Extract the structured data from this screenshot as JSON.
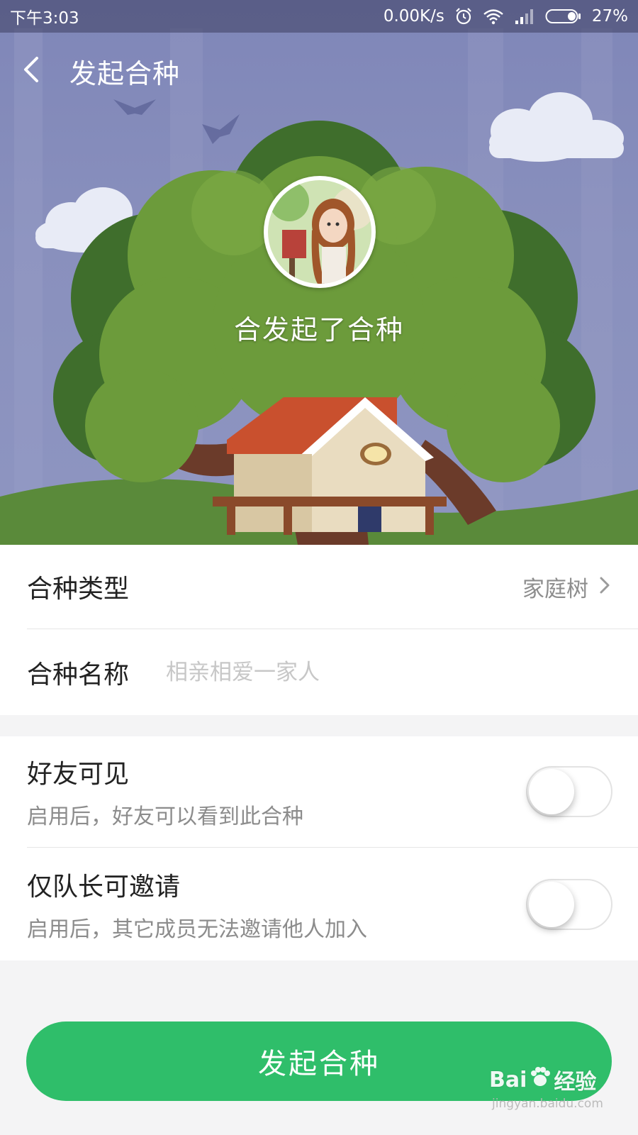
{
  "status_bar": {
    "time": "下午3:03",
    "network_speed": "0.00K/s",
    "battery": "27%",
    "icons": [
      "alarm-icon",
      "wifi-icon",
      "signal-icon",
      "battery-icon"
    ]
  },
  "nav": {
    "back_icon": "chevron-left-icon",
    "title": "发起合种"
  },
  "hero": {
    "caption": "合发起了合种"
  },
  "form": {
    "type_label": "合种类型",
    "type_value": "家庭树",
    "name_label": "合种名称",
    "name_value": "",
    "name_placeholder": "相亲相爱一家人"
  },
  "options": [
    {
      "title": "好友可见",
      "description": "启用后，好友可以看到此合种",
      "enabled": false
    },
    {
      "title": "仅队长可邀请",
      "description": "启用后，其它成员无法邀请他人加入",
      "enabled": false
    }
  ],
  "submit_label": "发起合种",
  "watermark": {
    "brand": "Bai",
    "brand_suffix": "经验",
    "url": "jingyan.baidu.com"
  },
  "colors": {
    "accent": "#2fbe6a",
    "hero_sky": "#8990bd",
    "tree_green": "#6a9a3a",
    "muted_text": "#8c8c8c",
    "placeholder": "#c7c7c7"
  }
}
